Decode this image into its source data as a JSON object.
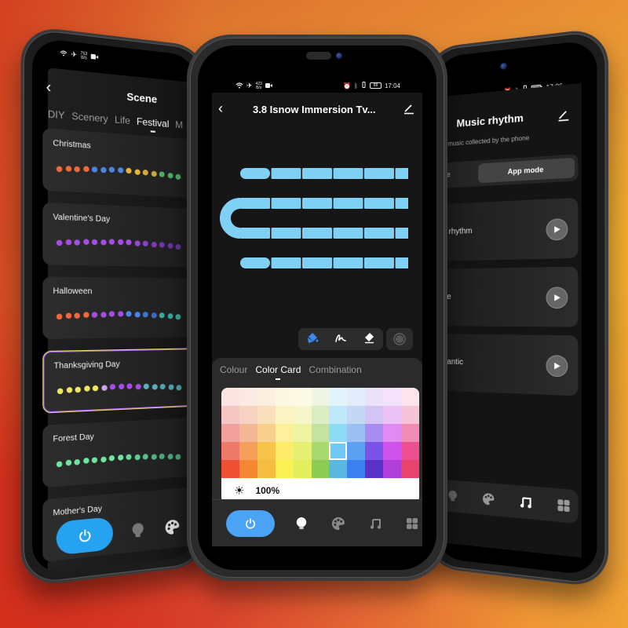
{
  "colors": {
    "accent_blue": "#26a3f0",
    "center_power_blue": "#4aa3f5",
    "strip_blue": "#7fd0f5",
    "selected_card_border": "#e8e070"
  },
  "left_phone": {
    "status": {
      "net_speed": "753",
      "net_unit": "B/s",
      "icons": [
        "wifi-icon",
        "airplane-icon",
        "video-icon"
      ]
    },
    "header": {
      "back_icon": "chevron-left-icon",
      "title": "Scene"
    },
    "tabs": [
      {
        "label": "DIY",
        "active": false
      },
      {
        "label": "Scenery",
        "active": false
      },
      {
        "label": "Life",
        "active": false
      },
      {
        "label": "Festival",
        "active": true
      },
      {
        "label": "M",
        "active": false
      }
    ],
    "scenes": [
      {
        "name": "Christmas",
        "selected": false,
        "dot_colors": [
          "#f06a3c",
          "#f06a3c",
          "#f06a3c",
          "#f06a3c",
          "#4a86e8",
          "#4a86e8",
          "#4a86e8",
          "#4a86e8",
          "#e2b43c",
          "#e2b43c",
          "#d8ac3c",
          "#c8a83c",
          "#4caf64",
          "#4caf64",
          "#4caf64"
        ]
      },
      {
        "name": "Valentine's Day",
        "selected": false,
        "dot_colors": [
          "#a64ce8",
          "#a64ce8",
          "#a64ce8",
          "#a64ce8",
          "#a64ce8",
          "#a64ce8",
          "#a64ce8",
          "#a64ce8",
          "#a64ce8",
          "#9a46d8",
          "#8c40c8",
          "#7e3ab8",
          "#7036a8",
          "#6a32a0",
          "#6a32a0"
        ]
      },
      {
        "name": "Halloween",
        "selected": false,
        "dot_colors": [
          "#f06a3c",
          "#f06a3c",
          "#f06a3c",
          "#f06a3c",
          "#a64ce8",
          "#a64ce8",
          "#a64ce8",
          "#a64ce8",
          "#4a86e8",
          "#4a86e8",
          "#3e74d0",
          "#3a6ac0",
          "#3aa89a",
          "#3aa89a",
          "#3aa89a"
        ]
      },
      {
        "name": "Thanksgiving Day",
        "selected": true,
        "dot_colors": [
          "#f0e860",
          "#f0e860",
          "#f0e860",
          "#f0e860",
          "#f0e860",
          "#c8a8e8",
          "#a64ce8",
          "#a64ce8",
          "#a64ce8",
          "#a64ce8",
          "#5ab0c0",
          "#5ab0c0",
          "#50a4b4",
          "#50a4b4",
          "#50a4b4"
        ]
      },
      {
        "name": "Forest Day",
        "selected": false,
        "dot_colors": [
          "#6ee6a0",
          "#6ee6a0",
          "#6ee6a0",
          "#6ee6a0",
          "#6ee6a0",
          "#6ee6a0",
          "#6ee6a0",
          "#6ee6a0",
          "#66d898",
          "#60cc90",
          "#58c088",
          "#50b480",
          "#4aa878",
          "#4aa878",
          "#4aa878"
        ]
      },
      {
        "name": "Mother's Day",
        "selected": false,
        "dot_colors": [
          "#8a5ac8",
          "#8a5ac8",
          "#8a5ac8",
          "#8a5ac8",
          "#8a5ac8",
          "#8a5ac8"
        ]
      }
    ],
    "bottom_nav": [
      {
        "icon": "power-icon",
        "active": true
      },
      {
        "icon": "bulb-icon",
        "active": false
      },
      {
        "icon": "palette-icon",
        "active": false
      }
    ]
  },
  "center_phone": {
    "status": {
      "net_speed": "423",
      "net_unit": "B/s",
      "battery": "88",
      "time": "17:04"
    },
    "header": {
      "back_icon": "chevron-left-icon",
      "title": "3.8 Isnow Immersion Tv...",
      "edit_icon": "edit-icon"
    },
    "light_strip": {
      "rows": 4,
      "segments_per_row": 6,
      "color": "#7fd0f5"
    },
    "tools": [
      {
        "icon": "paint-bucket-icon",
        "active": true
      },
      {
        "icon": "brush-icon",
        "active": false
      },
      {
        "icon": "eraser-icon",
        "active": false
      },
      {
        "icon": "record-icon",
        "active": false
      }
    ],
    "color_panel": {
      "tabs": [
        {
          "label": "Colour",
          "active": false
        },
        {
          "label": "Color Card",
          "active": true
        },
        {
          "label": "Combination",
          "active": false
        }
      ],
      "grid": [
        [
          "#fbe4e2",
          "#fbe9e3",
          "#fcefe2",
          "#fdf8e2",
          "#fcfae4",
          "#eef5e2",
          "#e2f4fb",
          "#e2ecfb",
          "#ebe2f8",
          "#f4e2fb",
          "#fbe4ec"
        ],
        [
          "#f6c6c4",
          "#f6d2c0",
          "#f8e0bc",
          "#fdf4c4",
          "#f6f6c8",
          "#dcecc4",
          "#bde9f8",
          "#c4d8f6",
          "#d2c4f4",
          "#eac4f6",
          "#f6c4d8"
        ],
        [
          "#f2a09c",
          "#f4b894",
          "#f6d08c",
          "#fcf09c",
          "#eef4a0",
          "#c6e2a0",
          "#8cdcf4",
          "#9cc0f2",
          "#a88cf0",
          "#de8cf2",
          "#f08cb4"
        ],
        [
          "#f07a6a",
          "#f4a05a",
          "#f6c44a",
          "#fcec6a",
          "#e6f070",
          "#a8d870",
          "#6ecaf4",
          "#5ca0f0",
          "#7a54e8",
          "#d052ec",
          "#ec5090"
        ],
        [
          "#ee5034",
          "#f48634",
          "#f4bc40",
          "#fbf054",
          "#e2ee5c",
          "#8ccc54",
          "#5ab8e0",
          "#3a80ee",
          "#5a32c8",
          "#b03ed8",
          "#e8446e"
        ]
      ],
      "selected_cell": {
        "row": 3,
        "col": 6
      },
      "brightness_icon": "sun-icon",
      "brightness_percent": 100,
      "brightness_label": "100%"
    },
    "bottom_nav": [
      {
        "icon": "power-icon",
        "active": true
      },
      {
        "icon": "bulb-icon",
        "active": true
      },
      {
        "icon": "palette-icon",
        "active": false
      },
      {
        "icon": "music-icon",
        "active": false
      },
      {
        "icon": "grid-icon",
        "active": false
      }
    ]
  },
  "right_phone": {
    "status": {
      "time": "17:06"
    },
    "header": {
      "title": "Music rhythm",
      "edit_icon": "edit-icon"
    },
    "subtitle": "e music collected by the phone",
    "mode": {
      "left_label": "de",
      "right_label": "App mode",
      "active": "App mode"
    },
    "items": [
      {
        "name": "c rhythm"
      },
      {
        "name": "ne"
      },
      {
        "name": "nantic"
      }
    ],
    "bottom_nav": [
      {
        "icon": "bulb-icon",
        "active": false
      },
      {
        "icon": "palette-icon",
        "active": false
      },
      {
        "icon": "music-icon",
        "active": true
      },
      {
        "icon": "grid-icon",
        "active": false
      }
    ]
  }
}
